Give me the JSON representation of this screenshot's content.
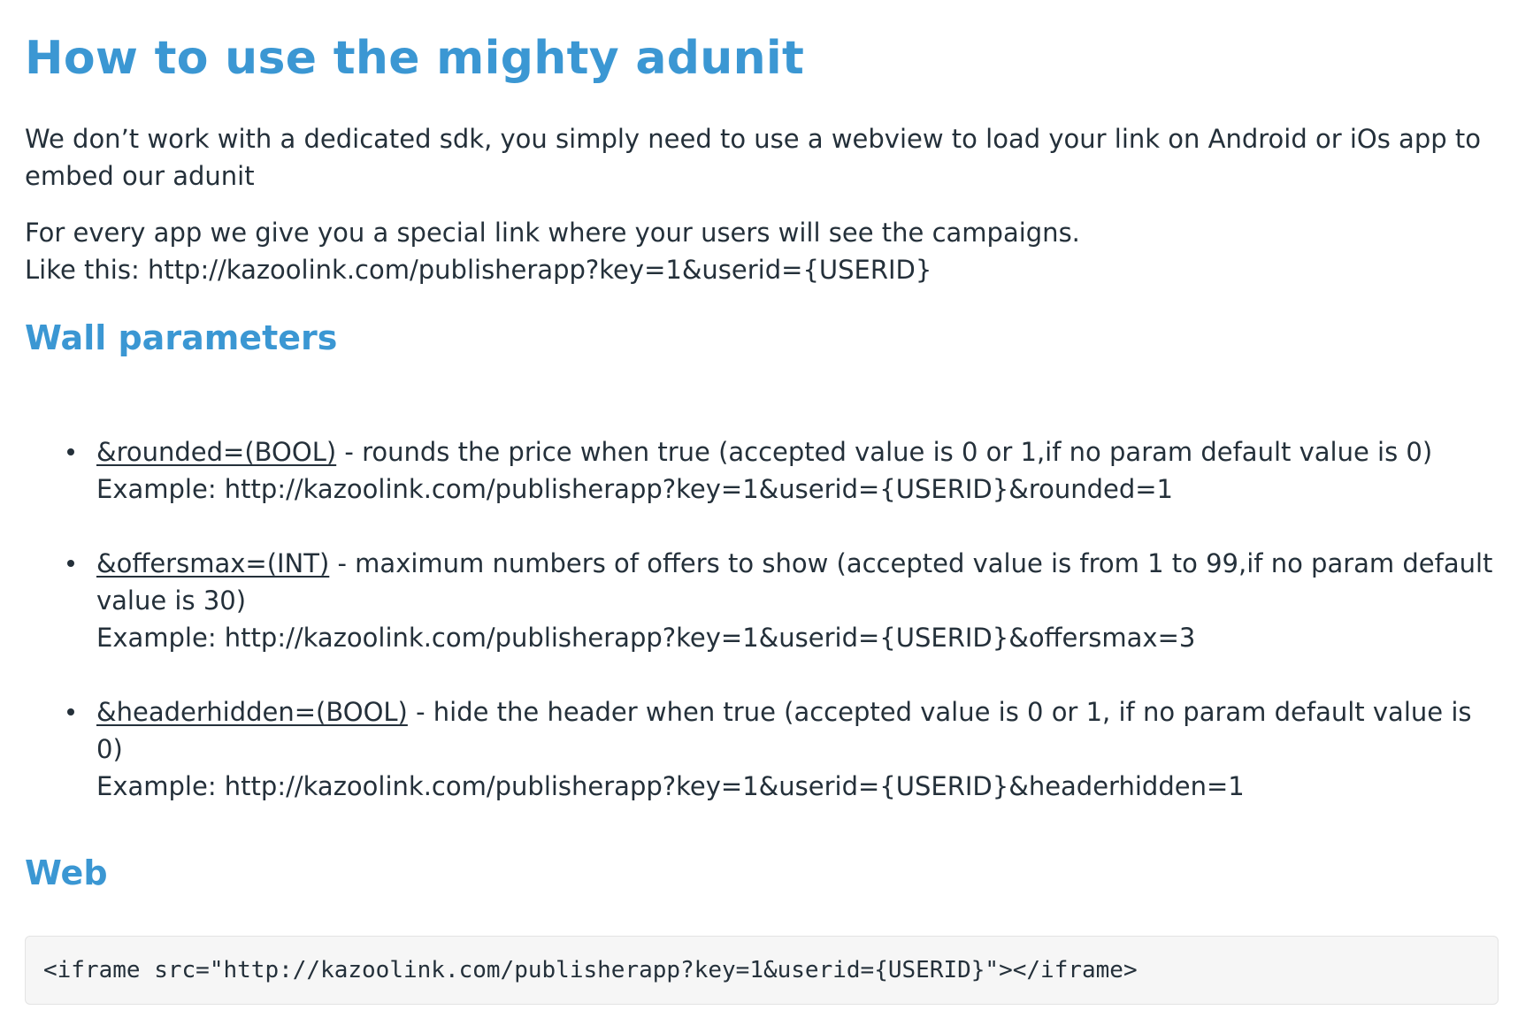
{
  "page": {
    "title": "How to use the mighty adunit",
    "intro": "We don’t work with a dedicated sdk, you simply need to use a webview to load your link on Android or iOs app to embed our adunit",
    "link_line_1": "For every app we give you a special link where your users will see the campaigns.",
    "link_line_2": "Like this: http://kazoolink.com/publisherapp?key=1&userid={USERID}"
  },
  "wall_parameters": {
    "heading": "Wall parameters",
    "items": [
      {
        "name": "&rounded=(BOOL)",
        "description": " - rounds the price when true (accepted value is 0 or 1,if no param default value is 0)",
        "example": "Example: http://kazoolink.com/publisherapp?key=1&userid={USERID}&rounded=1"
      },
      {
        "name": "&offersmax=(INT)",
        "description": " - maximum numbers of offers to show (accepted value is from 1 to 99,if no param default value is 30)",
        "example": "Example: http://kazoolink.com/publisherapp?key=1&userid={USERID}&offersmax=3"
      },
      {
        "name": "&headerhidden=(BOOL)",
        "description": " - hide the header when true (accepted value is 0 or 1, if no param default value is 0)",
        "example": "Example: http://kazoolink.com/publisherapp?key=1&userid={USERID}&headerhidden=1"
      }
    ]
  },
  "web": {
    "heading": "Web",
    "code": "<iframe src=\"http://kazoolink.com/publisherapp?key=1&userid={USERID}\"></iframe>"
  },
  "colors": {
    "heading": "#3b97d3",
    "text": "#24303a",
    "code_background": "#f6f6f6"
  }
}
